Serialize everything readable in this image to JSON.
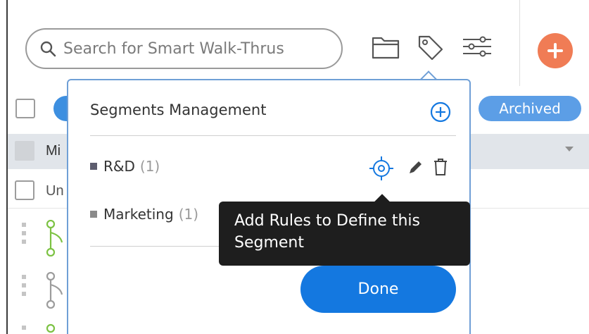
{
  "search": {
    "placeholder": "Search for Smart Walk-Thrus"
  },
  "toolbar": {
    "icons": [
      "folder-icon",
      "tag-icon",
      "filter-sliders-icon",
      "add-icon"
    ],
    "accent_color": "#f07c55"
  },
  "filters": {
    "archived_label": "Archived"
  },
  "list": {
    "group_row_label": "Mi",
    "unassigned_row_label": "Un"
  },
  "popover": {
    "title": "Segments Management",
    "segments": [
      {
        "name": "R&D",
        "count": "(1)",
        "color": "#5d5d6e"
      },
      {
        "name": "Marketing",
        "count": "(1)",
        "color": "#8a8a8a"
      }
    ],
    "done_label": "Done",
    "accent_color": "#1478e0"
  },
  "tooltip": {
    "text": "Add Rules to Define this Segment"
  }
}
